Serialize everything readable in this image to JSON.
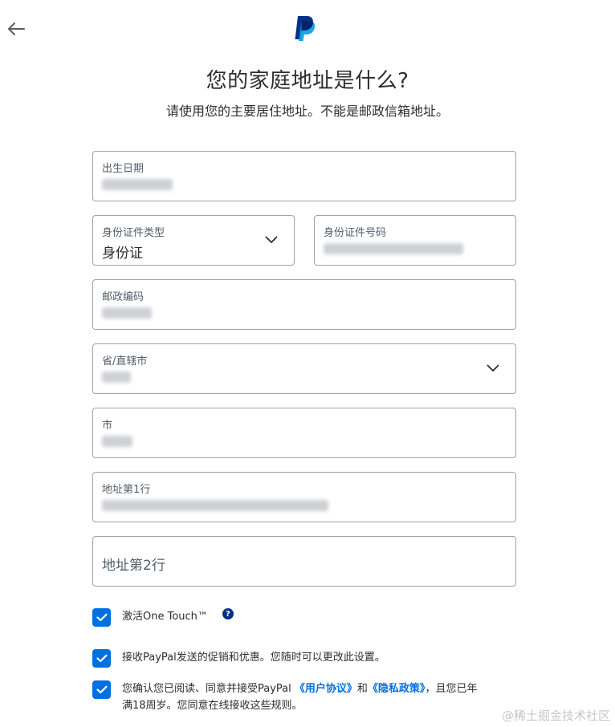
{
  "header": {
    "title": "您的家庭地址是什么?",
    "subtitle": "请使用您的主要居住地址。不能是邮政信箱地址。"
  },
  "icons": {
    "back": "arrow-left-icon",
    "logo": "paypal-logo",
    "chevron": "chevron-down-icon",
    "check": "checkmark-icon",
    "help": "question-circle-icon"
  },
  "form": {
    "dob_label": "出生日期",
    "id_type_label": "身份证件类型",
    "id_type_value": "身份证",
    "id_number_label": "身份证件号码",
    "postal_label": "邮政编码",
    "province_label": "省/直辖市",
    "city_label": "市",
    "address1_label": "地址第1行",
    "address2_placeholder": "地址第2行"
  },
  "consents": {
    "one_touch": "激活One Touch™",
    "help_glyph": "?",
    "marketing": "接收PayPal发送的促销和优惠。您随时可以更改此设置。",
    "agree_prefix": "您确认您已阅读、同意并接受PayPal ",
    "user_agreement": "《用户协议》",
    "and": "和",
    "privacy_policy": "《隐私政策》",
    "agree_suffix_1": "，且您已年",
    "agree_suffix_2": "满18周岁。您同意在线接收这些规则。"
  },
  "watermark": "@稀土掘金技术社区",
  "colors": {
    "accent": "#0070e0",
    "paypal_dark": "#003087",
    "paypal_light": "#009cde",
    "border": "#9da3a6"
  }
}
